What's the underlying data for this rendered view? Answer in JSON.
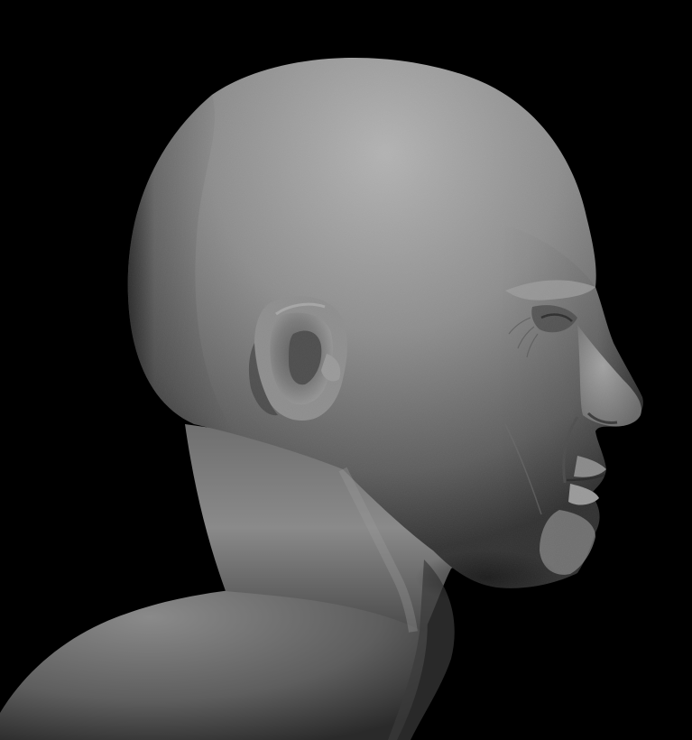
{
  "scene": {
    "subject": "sculpted-head-profile",
    "render_style": "grey-clay",
    "facing": "right"
  },
  "colors": {
    "background": "#000000",
    "clay_highlight": "#a9a9a9",
    "clay_mid": "#7d7d7d",
    "clay_shadow": "#3f3f3f",
    "clay_deep_shadow": "#1c1c1c"
  }
}
